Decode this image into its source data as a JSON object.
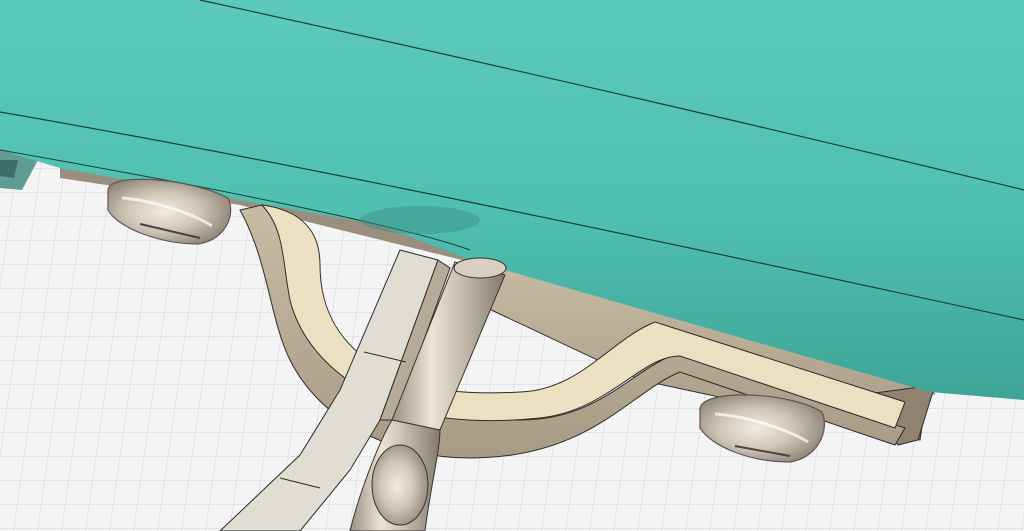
{
  "viewport": {
    "kind": "3d-cad-viewport",
    "grid_visible": true
  },
  "colors": {
    "background": "#f4f4f4",
    "grid_line": "#d2d2d2",
    "teal_body": "#52c4b4",
    "teal_edge": "#2a6e64",
    "bracket_face": "#ece0c2",
    "bracket_side": "#b8ab94",
    "metal_light": "#e6ddd0",
    "metal_dark": "#8e8478",
    "edge_line": "#2b2b2b"
  },
  "icons": {
    "teal_body": "teal-surface-icon",
    "bracket": "curved-bracket-icon",
    "rod": "cylinder-rod-icon",
    "pads": "rounded-pad-icon"
  }
}
